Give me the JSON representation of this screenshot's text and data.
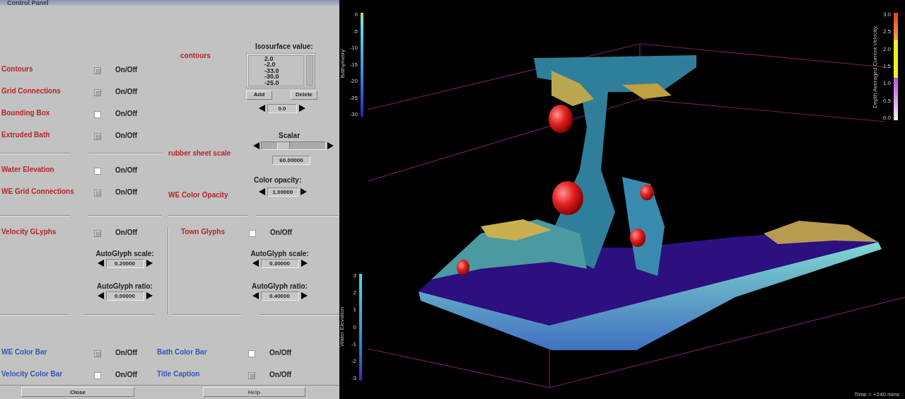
{
  "window": {
    "title": "Control Panel"
  },
  "display_toggles": [
    {
      "label": "Contours",
      "checked": true,
      "toggle_text": "On/Off"
    },
    {
      "label": "Grid Connections",
      "checked": true,
      "toggle_text": "On/Off"
    },
    {
      "label": "Bounding Box",
      "checked": false,
      "toggle_text": "On/Off"
    },
    {
      "label": "Extruded Bath",
      "checked": true,
      "toggle_text": "On/Off"
    }
  ],
  "water_toggles": [
    {
      "label": "Water Elevation",
      "checked": false,
      "toggle_text": "On/Off"
    },
    {
      "label": "WE Grid Connections",
      "checked": true,
      "toggle_text": "On/Off"
    }
  ],
  "contours": {
    "label": "contours",
    "list_title": "Isosurface value:",
    "values": [
      "2.0",
      "-2.0",
      "-33.0",
      "-30.0",
      "-25.0"
    ],
    "add_button": "Add",
    "delete_button": "Delete",
    "spinner_value": "0.0"
  },
  "rubber_sheet": {
    "label": "rubber sheet scale",
    "title": "Scalar",
    "level": 0.3,
    "value": "60.00000"
  },
  "opacity": {
    "label": "WE Color Opacity",
    "title": "Color opacity:",
    "value": "1.00000"
  },
  "glyph_groups": [
    {
      "label": "Velocity GLyphs",
      "checked": true,
      "toggle_text": "On/Off",
      "scale_title": "AutoGlyph scale:",
      "scale_value": "0.20000",
      "ratio_title": "AutoGlyph ratio:",
      "ratio_value": "0.00000"
    },
    {
      "label": "Town Glyphs",
      "checked": false,
      "toggle_text": "On/Off",
      "scale_title": "AutoGlyph scale:",
      "scale_value": "0.30000",
      "ratio_title": "AutoGlyph ratio:",
      "ratio_value": "0.40000"
    }
  ],
  "color_bar_toggles": [
    {
      "label": "WE Color Bar",
      "checked": true,
      "toggle_text": "On/Off"
    },
    {
      "label": "Bath Color Bar",
      "checked": false,
      "toggle_text": "On/Off"
    },
    {
      "label": "Velocity Color Bar",
      "checked": false,
      "toggle_text": "On/Off"
    },
    {
      "label": "Title Caption",
      "checked": true,
      "toggle_text": "On/Off"
    }
  ],
  "buttons": [
    {
      "label": "Close",
      "disabled": false
    },
    {
      "label": "Help",
      "disabled": true
    }
  ],
  "viewport": {
    "legends": [
      {
        "kind": "top_left",
        "title": "Bathymetry",
        "ticks": [
          "0",
          "-5",
          "-10",
          "-15",
          "-20",
          "-25",
          "-30"
        ]
      },
      {
        "kind": "top_right",
        "title": "Depth Averaged Current Velocity",
        "ticks": [
          "3.0",
          "2.5",
          "2.0",
          "1.5",
          "1.0",
          "0.5",
          "0.0"
        ]
      },
      {
        "kind": "bottom_left",
        "title": "Water Elevation",
        "ticks": [
          "3",
          "2",
          "1",
          "0",
          "-1",
          "-2",
          "-3"
        ]
      }
    ],
    "time_label": "Time = +240 mins"
  }
}
